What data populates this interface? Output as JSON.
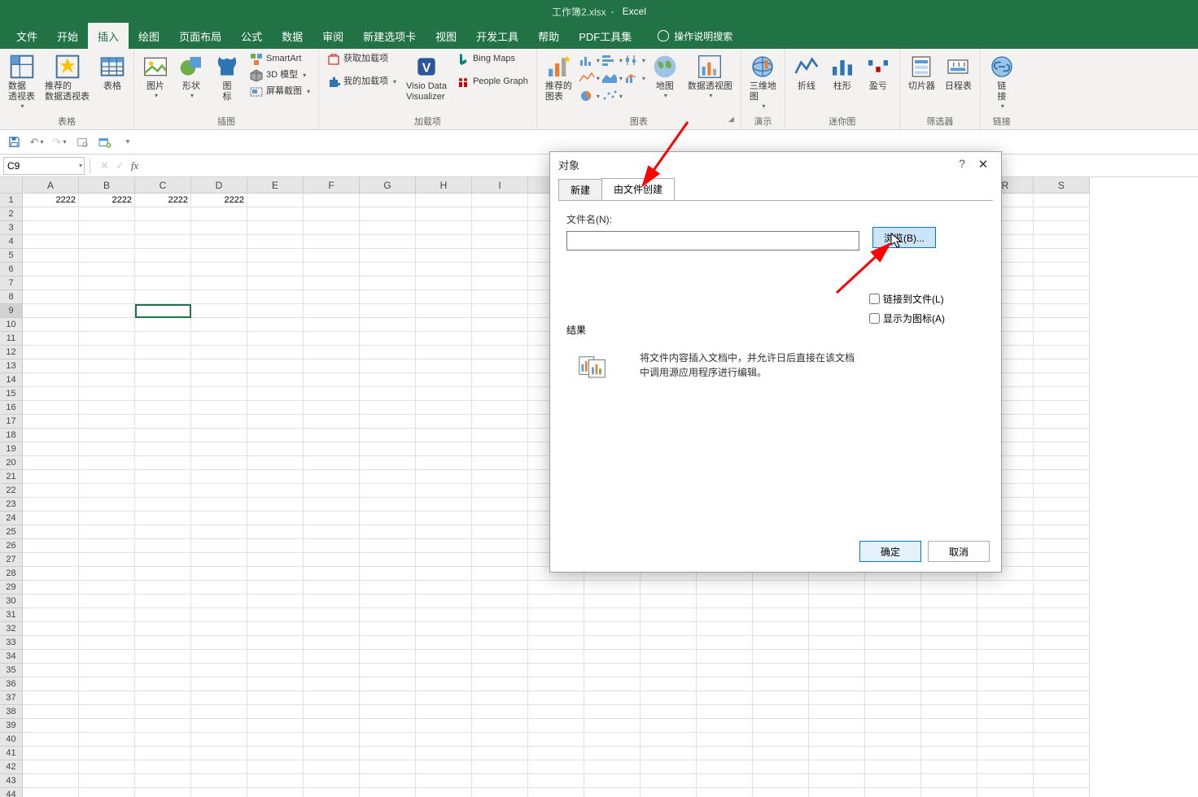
{
  "title": {
    "filename": "工作簿2.xlsx",
    "sep": "-",
    "app": "Excel"
  },
  "tabs": [
    "文件",
    "开始",
    "插入",
    "绘图",
    "页面布局",
    "公式",
    "数据",
    "审阅",
    "新建选项卡",
    "视图",
    "开发工具",
    "帮助",
    "PDF工具集"
  ],
  "active_tab_index": 2,
  "tell_me": "操作说明搜索",
  "ribbon": {
    "groups": [
      {
        "label": "表格",
        "buttons_large": [
          {
            "n": "数据\n透视表"
          },
          {
            "n": "推荐的\n数据透视表"
          },
          {
            "n": "表格"
          }
        ]
      },
      {
        "label": "插图",
        "buttons_large": [
          {
            "n": "图片"
          },
          {
            "n": "形状"
          },
          {
            "n": "图\n标"
          }
        ],
        "buttons_small": [
          {
            "n": "SmartArt"
          },
          {
            "n": "3D 模型"
          },
          {
            "n": "屏幕截图"
          }
        ]
      },
      {
        "label": "加载项",
        "buttons_small_left": [
          {
            "n": "获取加载项"
          },
          {
            "n": "我的加载项"
          }
        ],
        "buttons_large": [
          {
            "n": "Visio Data\nVisualizer"
          }
        ],
        "buttons_small": [
          {
            "n": "Bing Maps"
          },
          {
            "n": "People Graph"
          }
        ]
      },
      {
        "label": "图表",
        "buttons_large": [
          {
            "n": "推荐的\n图表"
          }
        ],
        "has_grid": true,
        "maps": "地图",
        "pivotchart": "数据透视图",
        "threed": "三维地\n图",
        "launcher": true
      },
      {
        "label": "演示"
      },
      {
        "label": "迷你图",
        "buttons_large": [
          {
            "n": "折线"
          },
          {
            "n": "柱形"
          },
          {
            "n": "盈亏"
          }
        ]
      },
      {
        "label": "筛选器",
        "buttons_large": [
          {
            "n": "切片器"
          },
          {
            "n": "日程表"
          }
        ]
      },
      {
        "label": "链接",
        "buttons_large": [
          {
            "n": "链\n接"
          }
        ]
      }
    ]
  },
  "name_box": "C9",
  "columns": [
    "A",
    "B",
    "C",
    "D",
    "E",
    "F",
    "G",
    "H",
    "I",
    "R",
    "S"
  ],
  "row_count": 33,
  "selected_row": 9,
  "cell_data": {
    "1": {
      "A": "2222",
      "B": "2222",
      "C": "2222",
      "D": "2222"
    }
  },
  "dialog": {
    "title": "对象",
    "help": "?",
    "tabs": [
      "新建",
      "由文件创建"
    ],
    "active": 1,
    "filename_label": "文件名(N):",
    "browse": "浏览(B)...",
    "link_to_file": "链接到文件(L)",
    "show_as_icon": "显示为图标(A)",
    "result_label": "结果",
    "result_text": "将文件内容插入文档中，并允许日后直接在该文档中调用源应用程序进行编辑。",
    "ok": "确定",
    "cancel": "取消"
  }
}
